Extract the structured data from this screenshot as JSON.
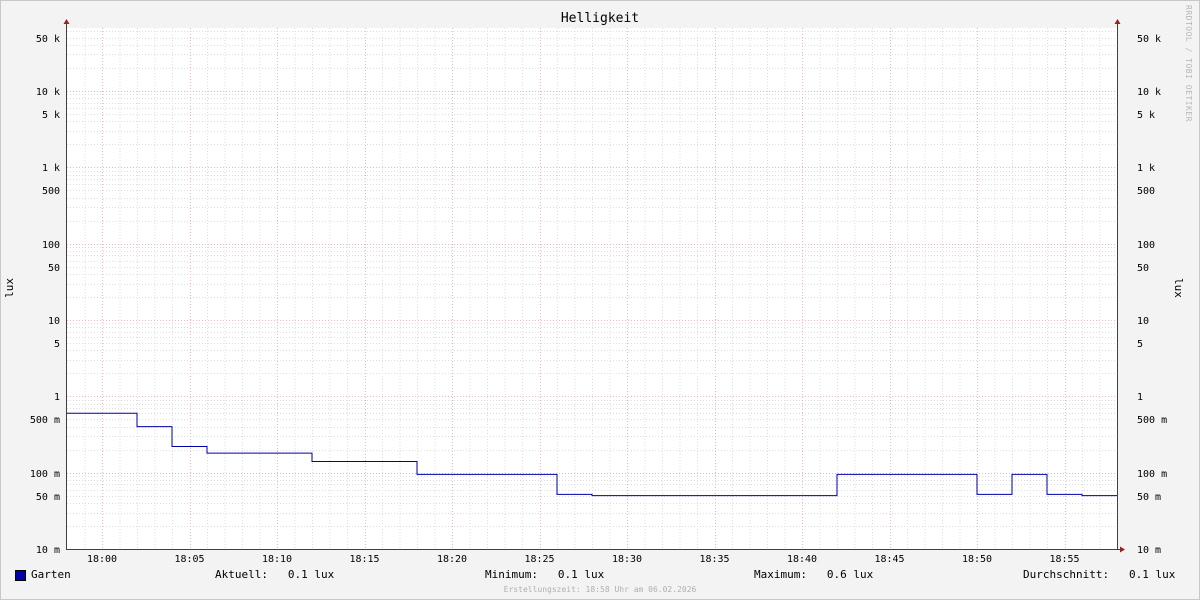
{
  "chart_data": {
    "type": "line",
    "title": "Helligkeit",
    "ylabel": "lux",
    "yscale": "log",
    "ylim": [
      0.01,
      80000
    ],
    "y_ticks": [
      {
        "v": 50000,
        "label": "50 k"
      },
      {
        "v": 10000,
        "label": "10 k"
      },
      {
        "v": 5000,
        "label": "5 k"
      },
      {
        "v": 1000,
        "label": "1 k"
      },
      {
        "v": 500,
        "label": "500"
      },
      {
        "v": 100,
        "label": "100"
      },
      {
        "v": 50,
        "label": "50"
      },
      {
        "v": 10,
        "label": "10"
      },
      {
        "v": 5,
        "label": "5"
      },
      {
        "v": 1,
        "label": "1"
      },
      {
        "v": 0.5,
        "label": "500 m"
      },
      {
        "v": 0.1,
        "label": "100 m"
      },
      {
        "v": 0.05,
        "label": "50 m"
      },
      {
        "v": 0.01,
        "label": "10 m"
      }
    ],
    "x_ticks": [
      "18:00",
      "18:05",
      "18:10",
      "18:15",
      "18:20",
      "18:25",
      "18:30",
      "18:35",
      "18:40",
      "18:45",
      "18:50",
      "18:55"
    ],
    "xlim": [
      "17:58",
      "18:58"
    ],
    "grid": true,
    "series": [
      {
        "name": "Garten",
        "color": "#0000aa",
        "steps": [
          {
            "x": "17:58",
            "y": 0.6
          },
          {
            "x": "18:02",
            "y": 0.4
          },
          {
            "x": "18:04",
            "y": 0.22
          },
          {
            "x": "18:06",
            "y": 0.18
          },
          {
            "x": "18:12",
            "y": 0.14
          },
          {
            "x": "18:18",
            "y": 0.095
          },
          {
            "x": "18:26",
            "y": 0.052
          },
          {
            "x": "18:28",
            "y": 0.05
          },
          {
            "x": "18:42",
            "y": 0.095
          },
          {
            "x": "18:50",
            "y": 0.052
          },
          {
            "x": "18:52",
            "y": 0.095
          },
          {
            "x": "18:54",
            "y": 0.052
          },
          {
            "x": "18:56",
            "y": 0.05
          },
          {
            "x": "18:58",
            "y": 0.05
          }
        ]
      }
    ]
  },
  "legend": {
    "name": "Garten",
    "color": "#0000aa",
    "current_label": "Aktuell:",
    "current_value": "0.1 lux",
    "min_label": "Minimum:",
    "min_value": "0.1 lux",
    "max_label": "Maximum:",
    "max_value": "0.6 lux",
    "avg_label": "Durchschnitt:",
    "avg_value": "0.1 lux"
  },
  "watermark": "RRDTOOL / TOBI OETIKER",
  "footer": "Erstellungszeit: 18:58 Uhr am 06.02.2026"
}
